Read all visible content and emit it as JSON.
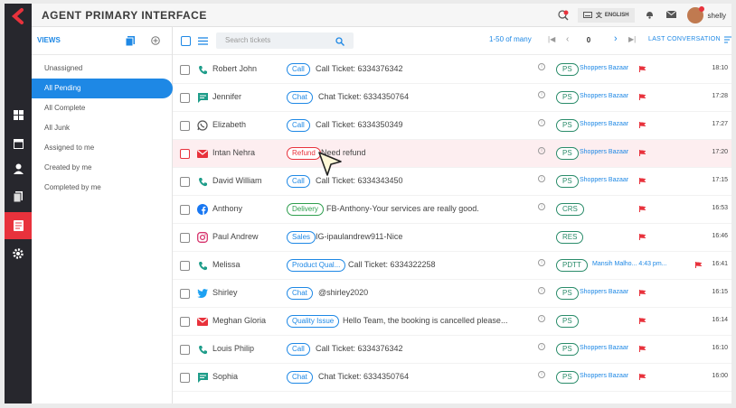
{
  "header": {
    "title": "AGENT PRIMARY INTERFACE",
    "language": "ENGLISH",
    "user": "shelly"
  },
  "views": {
    "title": "VIEWS",
    "items": [
      {
        "label": "Unassigned"
      },
      {
        "label": "All Pending"
      },
      {
        "label": "All Complete"
      },
      {
        "label": "All Junk"
      },
      {
        "label": "Assigned to me"
      },
      {
        "label": "Created by me"
      },
      {
        "label": "Completed by me"
      }
    ]
  },
  "toolbar": {
    "search_placeholder": "Search tickets",
    "pager_text": "1-50 of many",
    "page_number": "0",
    "sort_label": "LAST CONVERSATION"
  },
  "tickets": [
    {
      "name": "Robert John",
      "channel": "call-icon",
      "tag": "Call",
      "subject": "Call Ticket: 6334376342",
      "priority": "PS",
      "store": "Shoppers Bazaar",
      "time": "18:10"
    },
    {
      "name": "Jennifer",
      "channel": "chat-icon",
      "tag": "Chat",
      "subject": "Chat Ticket: 6334350764",
      "priority": "PS",
      "store": "Shoppers Bazaar",
      "time": "17:28"
    },
    {
      "name": "Elizabeth",
      "channel": "whatsapp-icon",
      "tag": "Call",
      "subject": "Call Ticket: 6334350349",
      "priority": "PS",
      "store": "Shoppers Bazaar",
      "time": "17:27"
    },
    {
      "name": "Intan Nehra",
      "channel": "email-icon",
      "tag": "Refund",
      "subject": "Need refund",
      "priority": "PS",
      "store": "Shoppers Bazaar",
      "time": "17:20"
    },
    {
      "name": "David William",
      "channel": "call-icon",
      "tag": "Call",
      "subject": "Call Ticket: 6334343450",
      "priority": "PS",
      "store": "Shoppers Bazaar",
      "time": "17:15"
    },
    {
      "name": "Anthony",
      "channel": "facebook-icon",
      "tag": "Delivery",
      "subject": "FB-Anthony-Your services are really good.",
      "priority": "CRS",
      "store": "",
      "time": "16:53"
    },
    {
      "name": "Paul Andrew",
      "channel": "instagram-icon",
      "tag": "Sales",
      "subject": "IG-ipaulandrew911-Nice",
      "priority": "RES",
      "store": "",
      "time": "16:46"
    },
    {
      "name": "Melissa",
      "channel": "call-icon",
      "tag": "Product Qual...",
      "subject": "Call Ticket: 6334322258",
      "priority": "PDTT",
      "store": "Mansih Malho... 4:43 pm...",
      "time": "16:41"
    },
    {
      "name": "Shirley",
      "channel": "twitter-icon",
      "tag": "Chat",
      "subject": "@shirley2020",
      "priority": "PS",
      "store": "Shoppers Bazaar",
      "time": "16:15"
    },
    {
      "name": "Meghan Gloria",
      "channel": "email-icon",
      "tag": "Quality Issue",
      "subject": "Hello Team, the booking is cancelled please...",
      "priority": "PS",
      "store": "",
      "time": "16:14"
    },
    {
      "name": "Louis Philip",
      "channel": "call-icon",
      "tag": "Call",
      "subject": "Call Ticket: 6334376342",
      "priority": "PS",
      "store": "Shoppers Bazaar",
      "time": "16:10"
    },
    {
      "name": "Sophia",
      "channel": "chat-icon",
      "tag": "Chat",
      "subject": "Chat Ticket: 6334350764",
      "priority": "PS",
      "store": "Shoppers Bazaar",
      "time": "16:00"
    }
  ],
  "colors": {
    "accent": "#1e88e5",
    "brand_red": "#e8323c",
    "rail": "#27272d"
  }
}
